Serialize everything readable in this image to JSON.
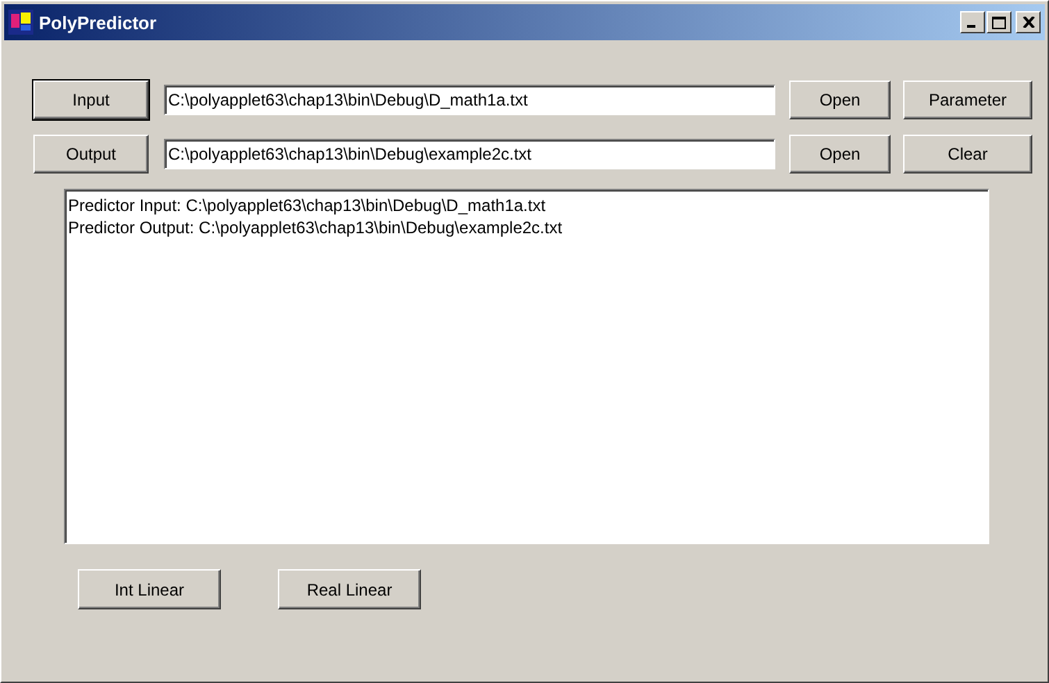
{
  "window": {
    "title": "PolyPredictor"
  },
  "file_rows": [
    {
      "button": {
        "label": "Input",
        "default": true
      },
      "path": "C:\\polyapplet63\\chap13\\bin\\Debug\\D_math1a.txt",
      "open": "Open",
      "action": "Parameter"
    },
    {
      "button": {
        "label": "Output",
        "default": false
      },
      "path": "C:\\polyapplet63\\chap13\\bin\\Debug\\example2c.txt",
      "open": "Open",
      "action": "Clear"
    }
  ],
  "log_lines": [
    "Predictor Input: C:\\polyapplet63\\chap13\\bin\\Debug\\D_math1a.txt",
    "Predictor Output: C:\\polyapplet63\\chap13\\bin\\Debug\\example2c.txt"
  ],
  "bottom_buttons": [
    "Int Linear",
    "Real Linear"
  ]
}
